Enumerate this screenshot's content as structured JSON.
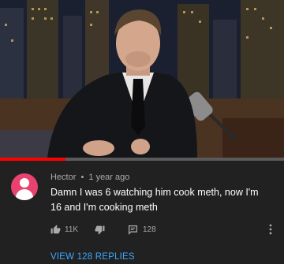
{
  "video": {
    "progress_fraction": 0.23,
    "progress_color": "#ff0000"
  },
  "comment": {
    "author": "Hector",
    "separator": "•",
    "time_ago": "1 year ago",
    "text": "Damn I was 6 watching him cook meth, now I'm 16 and I'm cooking meth",
    "avatar_color": "#e8436f",
    "likes": "11K",
    "reply_count": "128",
    "view_replies_label": "VIEW 128 REPLIES",
    "icons": [
      "thumbs-up-icon",
      "thumbs-down-icon",
      "comment-icon",
      "more-vert-icon"
    ]
  }
}
